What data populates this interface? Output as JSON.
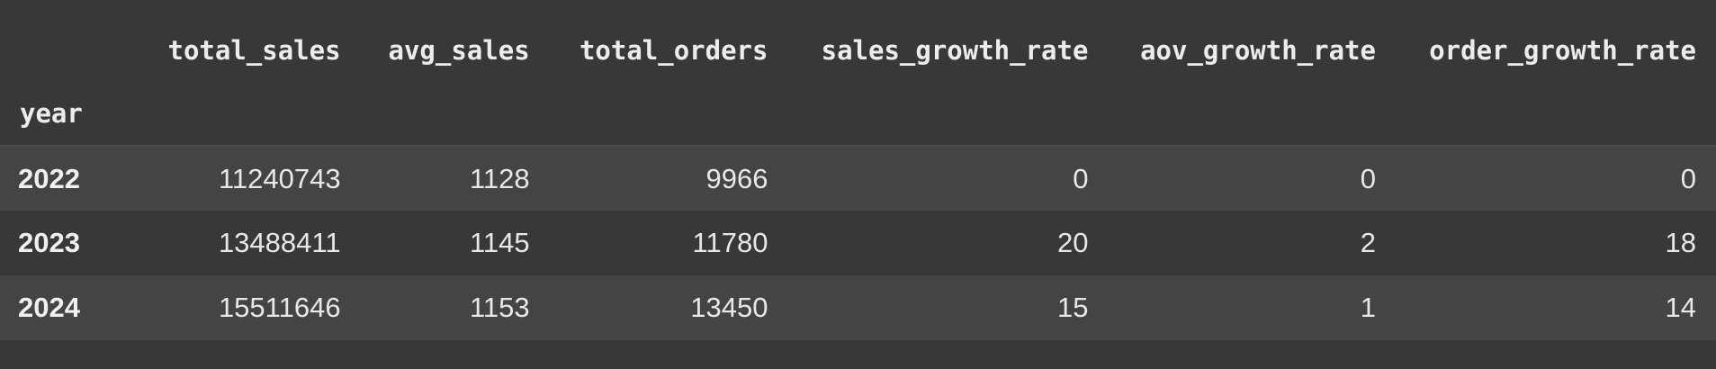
{
  "table": {
    "columns": [
      "total_sales",
      "avg_sales",
      "total_orders",
      "sales_growth_rate",
      "aov_growth_rate",
      "order_growth_rate"
    ],
    "index_name": "year",
    "rows": [
      {
        "index": "2022",
        "cells": [
          "11240743",
          "1128",
          "9966",
          "0",
          "0",
          "0"
        ]
      },
      {
        "index": "2023",
        "cells": [
          "13488411",
          "1145",
          "11780",
          "20",
          "2",
          "18"
        ]
      },
      {
        "index": "2024",
        "cells": [
          "15511646",
          "1153",
          "13450",
          "15",
          "1",
          "14"
        ]
      }
    ]
  },
  "colors": {
    "background": "#383838",
    "odd_row": "#444444",
    "text": "#e8e8e8"
  }
}
